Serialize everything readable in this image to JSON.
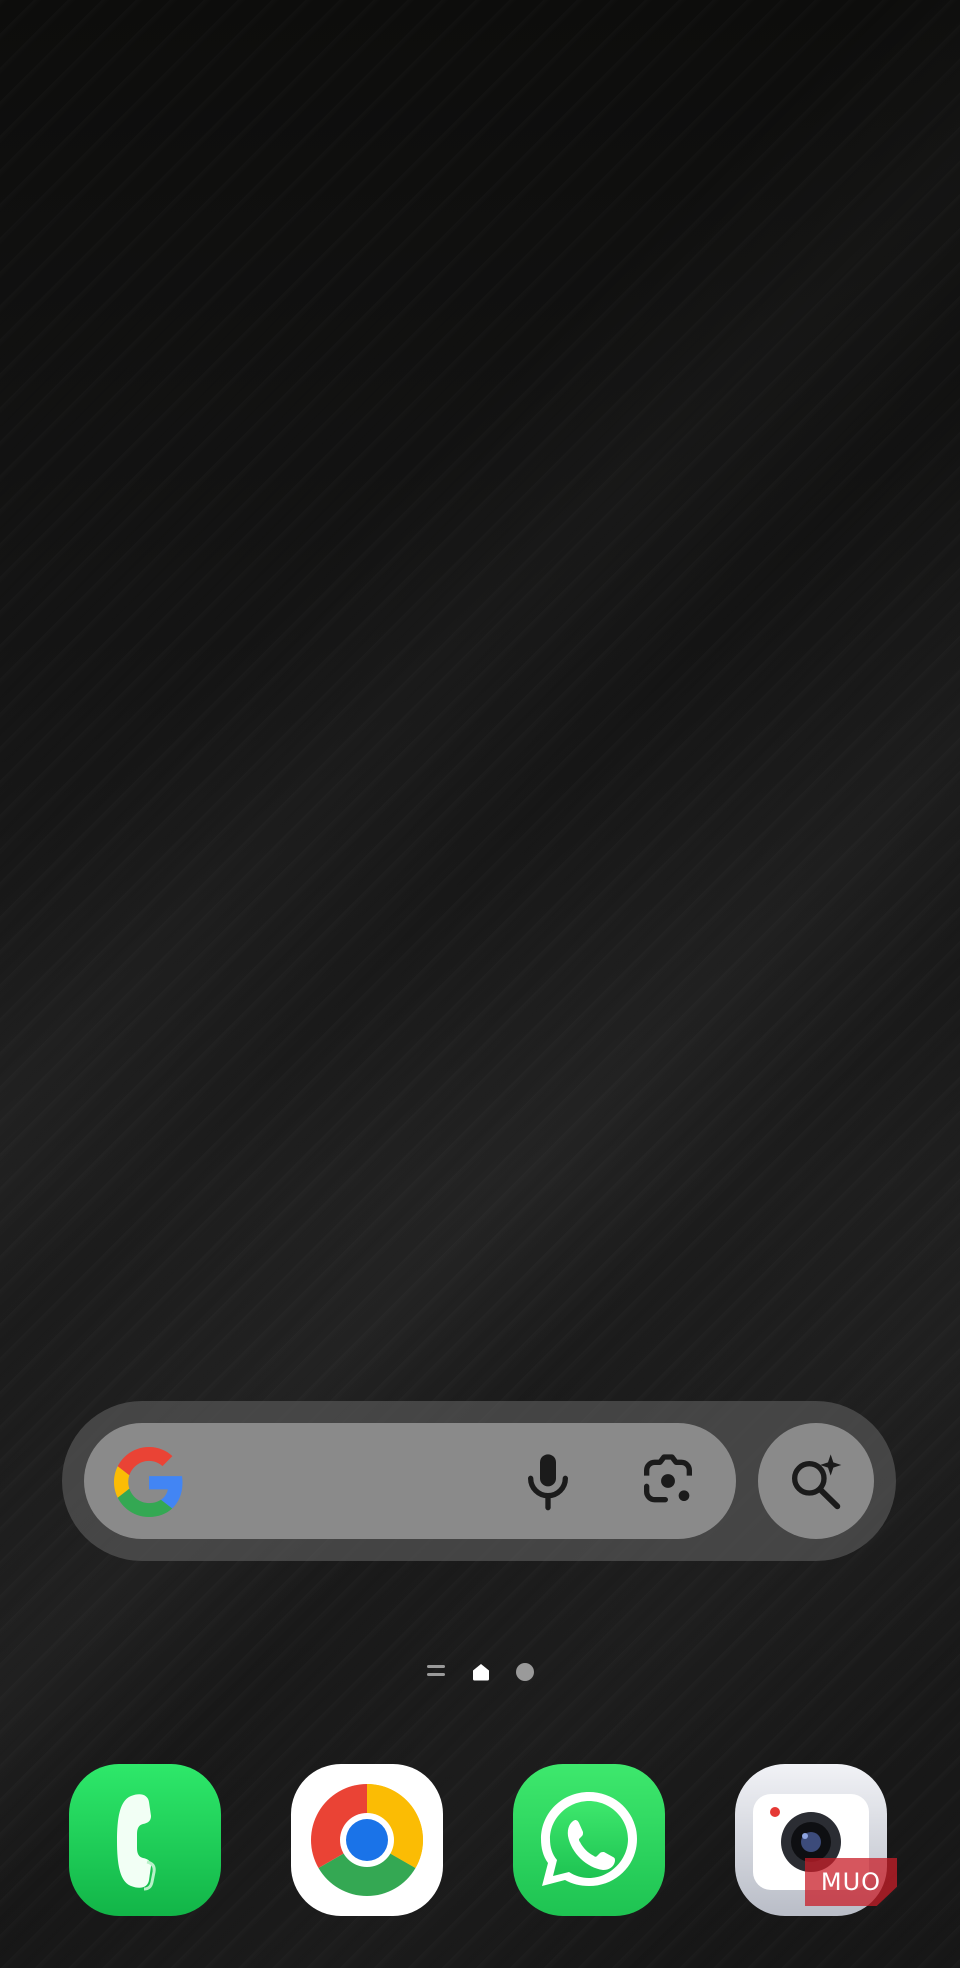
{
  "wallpaper": {
    "base_color": "#151515"
  },
  "search_widget": {
    "logo_icon": "google-g-icon",
    "mic_icon": "microphone-icon",
    "lens_icon": "google-lens-icon",
    "ai_mode_icon": "ai-search-sparkle-icon",
    "bar_color": "#8a8a8a",
    "container_color": "#555555"
  },
  "page_indicator": {
    "pages": [
      "app-list",
      "home",
      "page"
    ],
    "current": "home"
  },
  "dock": {
    "apps": [
      {
        "id": "phone",
        "icon": "phone-icon",
        "color": "#1fd15a"
      },
      {
        "id": "chrome",
        "icon": "chrome-icon",
        "color": "#ffffff"
      },
      {
        "id": "whatsapp",
        "icon": "whatsapp-icon",
        "color": "#25d366"
      },
      {
        "id": "camera",
        "icon": "camera-icon",
        "color": "#d9dce3"
      }
    ]
  },
  "watermark": {
    "text": "MUO"
  }
}
